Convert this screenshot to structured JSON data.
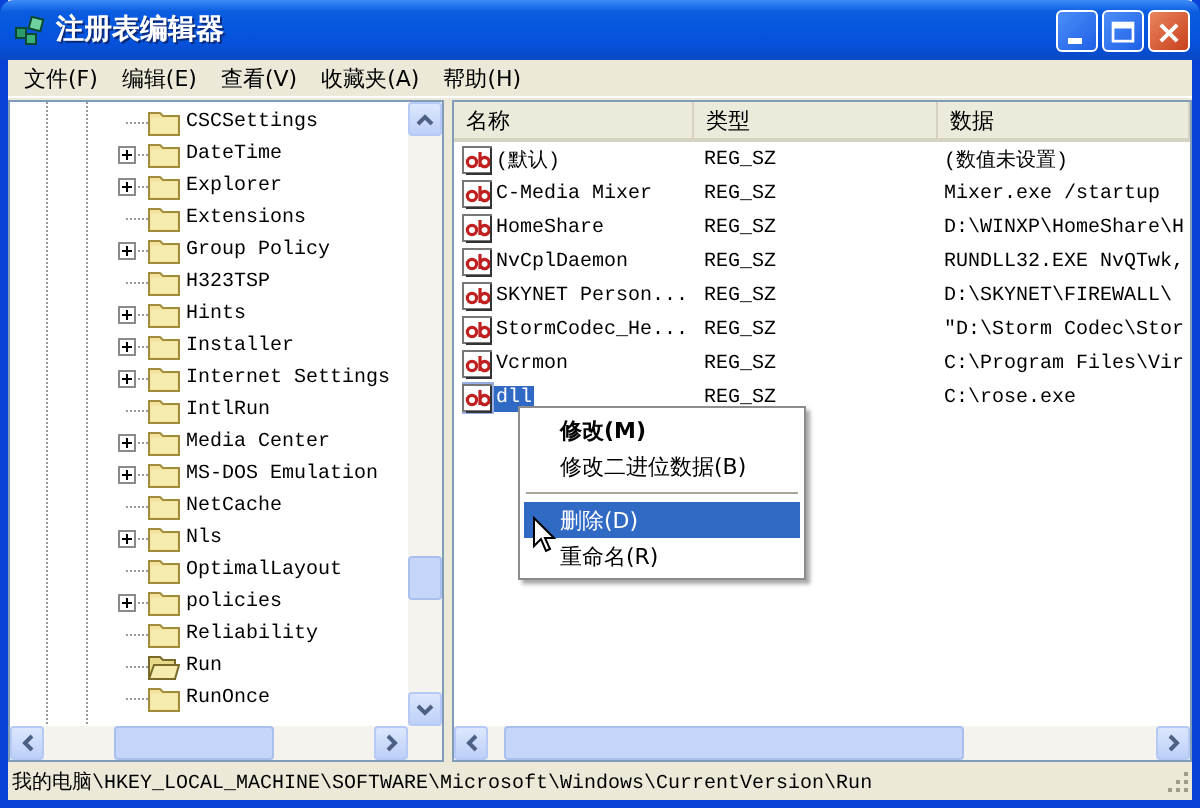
{
  "window": {
    "title": "注册表编辑器"
  },
  "menu": [
    "文件(F)",
    "编辑(E)",
    "查看(V)",
    "收藏夹(A)",
    "帮助(H)"
  ],
  "tree": {
    "items": [
      {
        "label": "CSCSettings",
        "has_children": false,
        "selected": false
      },
      {
        "label": "DateTime",
        "has_children": true,
        "selected": false
      },
      {
        "label": "Explorer",
        "has_children": true,
        "selected": false
      },
      {
        "label": "Extensions",
        "has_children": false,
        "selected": false
      },
      {
        "label": "Group Policy",
        "has_children": true,
        "selected": false
      },
      {
        "label": "H323TSP",
        "has_children": false,
        "selected": false
      },
      {
        "label": "Hints",
        "has_children": true,
        "selected": false
      },
      {
        "label": "Installer",
        "has_children": true,
        "selected": false
      },
      {
        "label": "Internet Settings",
        "has_children": true,
        "selected": false
      },
      {
        "label": "IntlRun",
        "has_children": false,
        "selected": false
      },
      {
        "label": "Media Center",
        "has_children": true,
        "selected": false
      },
      {
        "label": "MS-DOS Emulation",
        "has_children": true,
        "selected": false
      },
      {
        "label": "NetCache",
        "has_children": false,
        "selected": false
      },
      {
        "label": "Nls",
        "has_children": true,
        "selected": false
      },
      {
        "label": "OptimalLayout",
        "has_children": false,
        "selected": false
      },
      {
        "label": "policies",
        "has_children": true,
        "selected": false
      },
      {
        "label": "Reliability",
        "has_children": false,
        "selected": false
      },
      {
        "label": "Run",
        "has_children": false,
        "selected": true
      },
      {
        "label": "RunOnce",
        "has_children": false,
        "selected": false
      }
    ]
  },
  "values": {
    "columns": [
      "名称",
      "类型",
      "数据"
    ],
    "rows": [
      {
        "name": "(默认)",
        "type": "REG_SZ",
        "data": "(数值未设置)",
        "selected": false
      },
      {
        "name": "C-Media Mixer",
        "type": "REG_SZ",
        "data": "Mixer.exe /startup",
        "selected": false
      },
      {
        "name": "HomeShare",
        "type": "REG_SZ",
        "data": "D:\\WINXP\\HomeShare\\H",
        "selected": false
      },
      {
        "name": "NvCplDaemon",
        "type": "REG_SZ",
        "data": "RUNDLL32.EXE NvQTwk,",
        "selected": false
      },
      {
        "name": "SKYNET Person...",
        "type": "REG_SZ",
        "data": "D:\\SKYNET\\FIREWALL\\",
        "selected": false
      },
      {
        "name": "StormCodec_He...",
        "type": "REG_SZ",
        "data": "\"D:\\Storm Codec\\Stor",
        "selected": false
      },
      {
        "name": "Vcrmon",
        "type": "REG_SZ",
        "data": "C:\\Program Files\\Vir",
        "selected": false
      },
      {
        "name": "dll",
        "type": "REG_SZ",
        "data": "C:\\rose.exe",
        "selected": true
      }
    ]
  },
  "context_menu": [
    {
      "kind": "item",
      "label": "修改(M)",
      "default": true,
      "selected": false
    },
    {
      "kind": "item",
      "label": "修改二进位数据(B)",
      "default": false,
      "selected": false
    },
    {
      "kind": "separator"
    },
    {
      "kind": "item",
      "label": "删除(D)",
      "default": false,
      "selected": true
    },
    {
      "kind": "item",
      "label": "重命名(R)",
      "default": false,
      "selected": false
    }
  ],
  "status_bar": "我的电脑\\HKEY_LOCAL_MACHINE\\SOFTWARE\\Microsoft\\Windows\\CurrentVersion\\Run"
}
